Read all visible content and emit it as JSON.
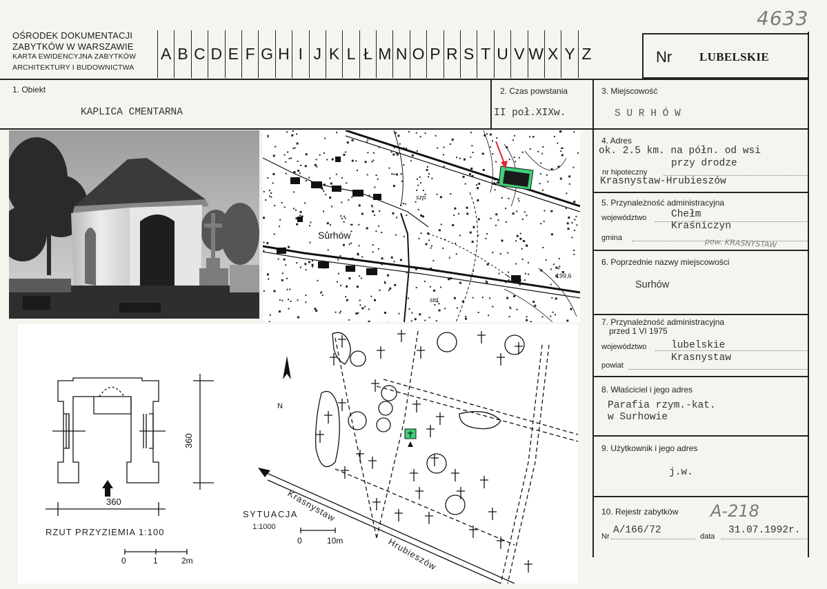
{
  "header": {
    "org_line1": "OŚRODEK DOKUMENTACJI",
    "org_line2": "ZABYTKÓW W WARSZAWIE",
    "org_line3": "KARTA EWIDENCYJNA ZABYTKÓW",
    "org_line4": "ARCHITEKTURY I BUDOWNICTWA",
    "letters": [
      "A",
      "B",
      "C",
      "D",
      "E",
      "F",
      "G",
      "H",
      "I",
      "J",
      "K",
      "L",
      "Ł",
      "M",
      "N",
      "O",
      "P",
      "R",
      "S",
      "T",
      "U",
      "V",
      "W",
      "X",
      "Y",
      "Z"
    ],
    "nr_label": "Nr",
    "nr_value": "LUBELSKIE",
    "handwritten_number": "4633"
  },
  "fields": {
    "obiekt_label": "1. Obiekt",
    "obiekt_value": "KAPLICA CMENTARNA",
    "czas_label": "2. Czas powstania",
    "czas_value": "II poł.XIXw.",
    "miejscowosc_label": "3. Miejscowość",
    "miejscowosc_value": "S U R H Ó W",
    "adres_label": "4. Adres",
    "adres_value1": "ok. 2.5 km. na półn. od wsi",
    "adres_value2": "przy drodze",
    "hipoteczny_label": "nr hipoteczny",
    "adres_value3": "Krasnystaw-Hrubieszów",
    "admin_label": "5. Przynależność administracyjna",
    "wojewodztwo_label": "województwo",
    "wojewodztwo_value": "Chełm",
    "gmina_value": "Kraśniczyn",
    "gmina_label": "gmina",
    "pow_handwritten": "pow. KRASNYSTAW",
    "poprzednie_label": "6. Poprzednie nazwy miejscowości",
    "poprzednie_value": "Surhów",
    "admin1975_label1": "7. Przynależność administracyjna",
    "admin1975_label2": "przed 1 VI 1975",
    "wojewodztwo1975_label": "województwo",
    "wojewodztwo1975_value": "lubelskie",
    "powiat_value": "Krasnystaw",
    "powiat_label": "powiat",
    "wlasciciel_label": "8. Właściciel i jego adres",
    "wlasciciel_value1": "Parafia rzym.-kat.",
    "wlasciciel_value2": "w Surhowie",
    "uzytkownik_label": "9. Użytkownik i jego adres",
    "uzytkownik_value": "j.w.",
    "rejestr_label": "10. Rejestr zabytków",
    "rejestr_handwritten": "A-218",
    "rejestr_nr_label": "Nr",
    "rejestr_nr_value": "A/166/72",
    "rejestr_data_label": "data",
    "rejestr_data_value": "31.07.1992r."
  },
  "map": {
    "place_label": "Surhów",
    "label_szp": "szp.",
    "label_std": "std",
    "elevation": "199,6"
  },
  "drawings": {
    "plan_dim_h": "360",
    "plan_dim_v": "360",
    "plan_title": "RZUT PRZYZIEMIA 1:100",
    "plan_scale_0": "0",
    "plan_scale_1": "1",
    "plan_scale_2": "2m",
    "north": "N",
    "site_title": "SYTUACJA",
    "site_scale": "1:1000",
    "site_scale_0": "0",
    "site_scale_10": "10m",
    "road_from": "Krasnystaw",
    "road_to": "Hrubieszów"
  },
  "colors": {
    "highlight_green": "#3fd07a",
    "arrow_red": "#e0262a"
  }
}
